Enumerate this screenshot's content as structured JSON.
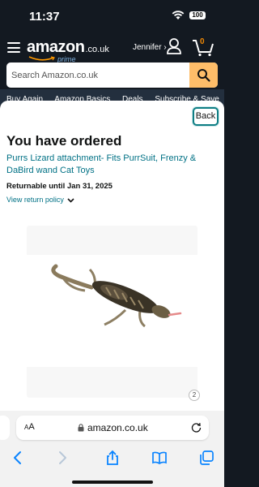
{
  "status_bar": {
    "time": "11:37",
    "battery": "100"
  },
  "header": {
    "logo_word": "amazon",
    "logo_tld": ".co.uk",
    "logo_sub": "prime",
    "account_name": "Jennifer ›",
    "cart_count": "0"
  },
  "search": {
    "placeholder": "Search Amazon.co.uk"
  },
  "nav_links": [
    "Buy Again",
    "Amazon Basics",
    "Deals",
    "Subscribe & Save"
  ],
  "sheet": {
    "back_label": "Back",
    "heading": "You have ordered",
    "product_title": "Purrs Lizard attachment- Fits PurrSuit, Frenzy & DaBird wand Cat Toys",
    "returnable": "Returnable until Jan 31, 2025",
    "return_policy_link": "View return policy",
    "image_counter": "2"
  },
  "browser": {
    "aa_label_small": "A",
    "aa_label_large": "A",
    "domain": "amazon.co.uk"
  },
  "colors": {
    "header_bg": "#131921",
    "link": "#007185",
    "search_button": "#febd69",
    "back_border": "#0e7e84",
    "browser_tint": "#0a84ff"
  },
  "icons": [
    "menu-icon",
    "account-icon",
    "cart-icon",
    "search-icon",
    "chevron-down-icon",
    "lock-icon",
    "reload-icon",
    "back-arrow-icon",
    "forward-arrow-icon",
    "share-icon",
    "bookmarks-icon",
    "tabs-icon"
  ]
}
